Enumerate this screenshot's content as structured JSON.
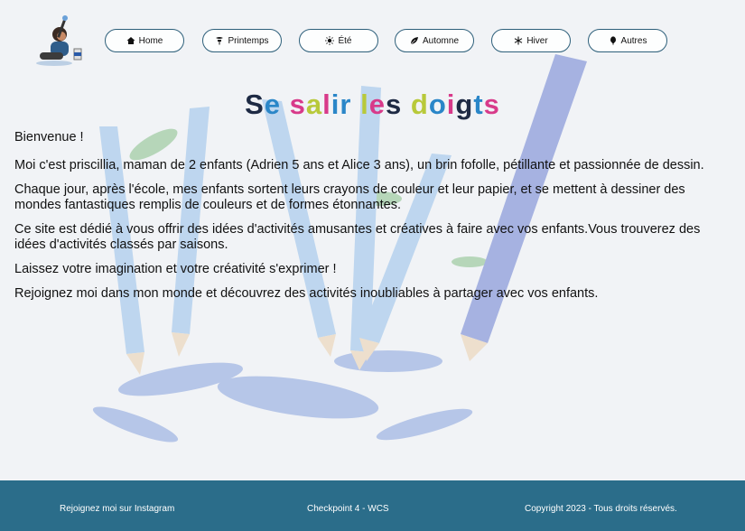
{
  "nav": [
    {
      "label": "Home",
      "icon": "home-icon"
    },
    {
      "label": "Printemps",
      "icon": "flower-icon"
    },
    {
      "label": "Été",
      "icon": "sun-icon"
    },
    {
      "label": "Automne",
      "icon": "leaf-icon"
    },
    {
      "label": "Hiver",
      "icon": "snowflake-icon"
    },
    {
      "label": "Autres",
      "icon": "balloon-icon"
    }
  ],
  "title": {
    "letters": [
      {
        "t": "S",
        "c": "#1e2a44"
      },
      {
        "t": "e",
        "c": "#2a86c8"
      },
      {
        "t": " ",
        "c": "#000"
      },
      {
        "t": "s",
        "c": "#d83a8a"
      },
      {
        "t": "a",
        "c": "#b8c93a"
      },
      {
        "t": "l",
        "c": "#d83a8a"
      },
      {
        "t": "i",
        "c": "#2a86c8"
      },
      {
        "t": "r",
        "c": "#2a86c8"
      },
      {
        "t": " ",
        "c": "#000"
      },
      {
        "t": "l",
        "c": "#b8c93a"
      },
      {
        "t": "e",
        "c": "#d83a8a"
      },
      {
        "t": "s",
        "c": "#1e2a44"
      },
      {
        "t": " ",
        "c": "#000"
      },
      {
        "t": "d",
        "c": "#b8c93a"
      },
      {
        "t": "o",
        "c": "#2a86c8"
      },
      {
        "t": "i",
        "c": "#d83a8a"
      },
      {
        "t": "g",
        "c": "#1e2a44"
      },
      {
        "t": "t",
        "c": "#2a86c8"
      },
      {
        "t": "s",
        "c": "#d83a8a"
      }
    ]
  },
  "content": {
    "p1": "Bienvenue !",
    "p2": "Moi c'est priscillia, maman de 2 enfants (Adrien 5 ans et Alice 3 ans), un brin fofolle, pétillante et passionnée de dessin.",
    "p3": "Chaque jour, après l'école, mes enfants sortent leurs crayons de couleur et leur papier, et se mettent à dessiner des mondes fantastiques remplis de couleurs et de formes étonnantes.",
    "p4": "Ce site est dédié à vous offrir des idées d'activités amusantes et créatives à faire avec vos enfants.Vous trouverez des idées d'activités classés par saisons.",
    "p5": "Laissez votre imagination et votre créativité s'exprimer !",
    "p6": "Rejoignez moi dans mon monde et découvrez des activités inoubliables à partager avec vos enfants."
  },
  "footer": {
    "instagram": "Rejoignez moi sur Instagram",
    "checkpoint": "Checkpoint 4 - WCS",
    "copyright": "Copyright 2023 - Tous droits réservés."
  },
  "colors": {
    "footer": "#2b6d8a",
    "nav_border": "#2d5f7a"
  }
}
